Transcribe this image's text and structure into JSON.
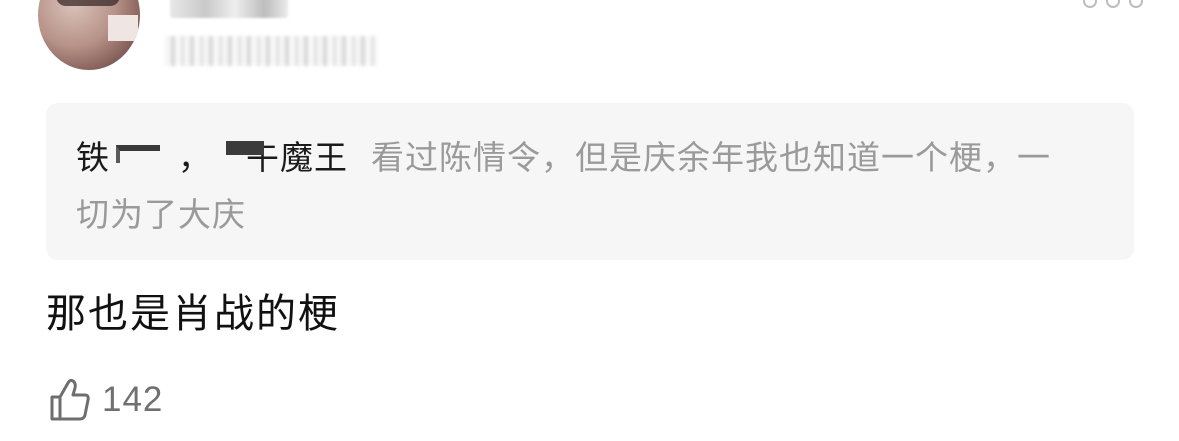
{
  "comment": {
    "quote": {
      "author": "铁  ， 午魔王",
      "text": "看过陈情令，但是庆余年我也知道一个梗，一切为了大庆"
    },
    "reply": "那也是肖战的梗",
    "likes": {
      "icon": "thumbs-up-icon",
      "count": "142"
    }
  },
  "colors": {
    "quote_background": "#f6f6f6",
    "quote_text": "#9a9a9a",
    "author_text": "#1a1a1a",
    "reply_text": "#111111",
    "like_text": "#707070"
  }
}
